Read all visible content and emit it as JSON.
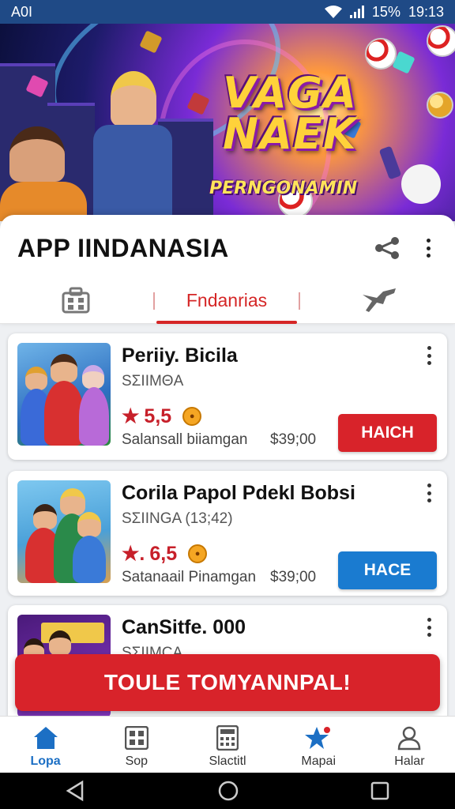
{
  "status_bar": {
    "carrier": "A0I",
    "battery": "15%",
    "time": "19:13"
  },
  "banner": {
    "title_line1": "VAGA",
    "title_line2": "NAEK",
    "subtitle": "PERNGONAMIN"
  },
  "header": {
    "app_title": "APP IINDANASIA",
    "share_icon": "share-icon",
    "more_icon": "more-vertical-icon"
  },
  "tabs": [
    {
      "icon": "briefcase-icon",
      "label": ""
    },
    {
      "label": "Fndanrias",
      "active": true
    },
    {
      "icon": "drone-icon",
      "label": ""
    }
  ],
  "items": [
    {
      "title": "Periiy. Bicila",
      "subtitle": "SΣIIMΘA",
      "rating": "5,5",
      "rating_prefix": "★",
      "meta": "Salansall biiamgan",
      "price": "$39;00",
      "button": "HAICH",
      "button_color": "#d8232a"
    },
    {
      "title": "Corila Papol Pdekl Bobsi",
      "subtitle": "SΣIINGA (13;42)",
      "rating": "6,5",
      "rating_prefix": "★.",
      "meta": "Satanaail Pinamgan",
      "price": "$39;00",
      "button": "HACE",
      "button_color": "#1a7bd0"
    },
    {
      "title": "CanSitfe. 000",
      "subtitle": "SΣIIMCA"
    }
  ],
  "cta": {
    "label": "TOULE TOMYANNPAL!"
  },
  "bottom_nav": [
    {
      "label": "Lopa",
      "icon": "home-icon",
      "active": true
    },
    {
      "label": "Sop",
      "icon": "grid-icon"
    },
    {
      "label": "Slactitl",
      "icon": "calculator-icon"
    },
    {
      "label": "Mapai",
      "icon": "star-icon"
    },
    {
      "label": "Halar",
      "icon": "person-icon"
    }
  ],
  "colors": {
    "accent_red": "#d8232a",
    "accent_blue": "#1a7bd0",
    "status_bar": "#1f4a86"
  }
}
